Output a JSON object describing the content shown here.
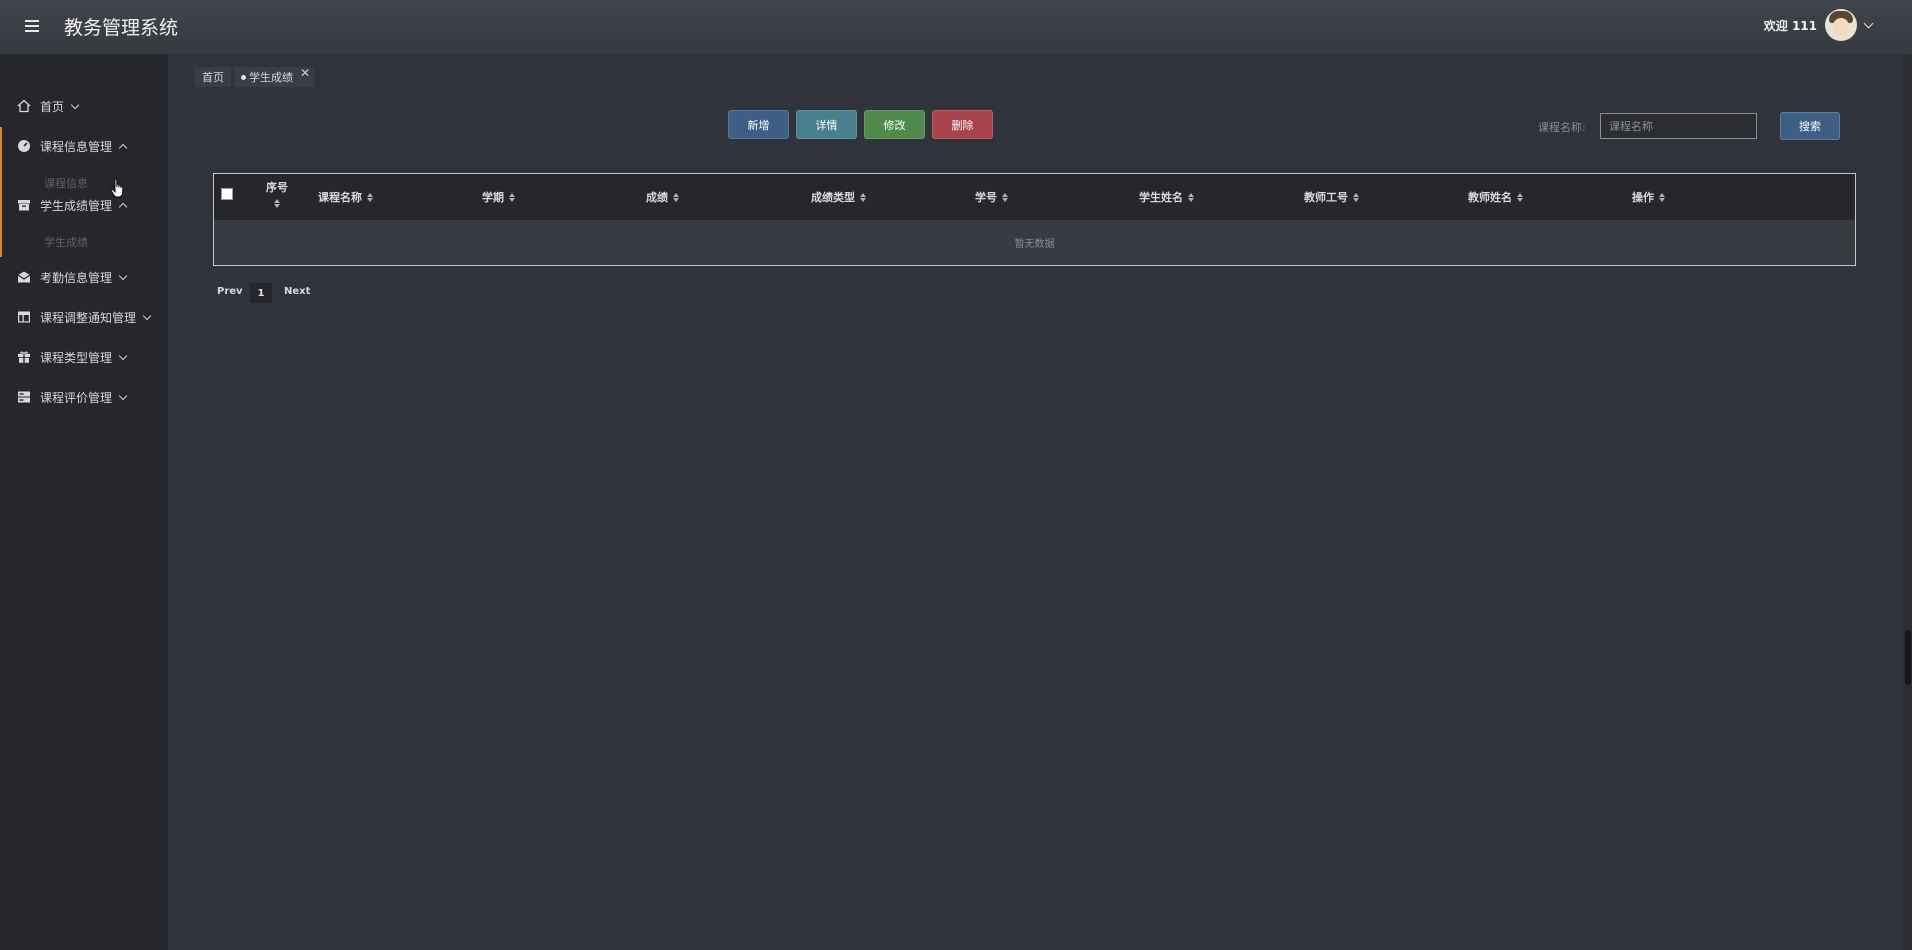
{
  "header": {
    "title": "教务管理系统",
    "welcome": "欢迎 111"
  },
  "sidebar": {
    "items": [
      {
        "label": "首页",
        "icon": "home-icon"
      },
      {
        "label": "课程信息管理",
        "icon": "dashboard-icon",
        "expanded": true
      },
      {
        "label": "学生成绩管理",
        "icon": "archive-icon",
        "expanded": true
      },
      {
        "label": "考勤信息管理",
        "icon": "envelope-icon"
      },
      {
        "label": "课程调整通知管理",
        "icon": "layout-icon"
      },
      {
        "label": "课程类型管理",
        "icon": "gift-icon"
      },
      {
        "label": "课程评价管理",
        "icon": "server-icon"
      }
    ],
    "sub_items": {
      "course_info": "课程信息",
      "student_grades": "学生成绩"
    }
  },
  "tabs": [
    {
      "label": "首页"
    },
    {
      "label": "学生成绩",
      "active": true
    }
  ],
  "tab_close": "✕",
  "toolbar": {
    "add": "新增",
    "detail": "详情",
    "edit": "修改",
    "delete": "删除"
  },
  "search": {
    "label": "课程名称:",
    "placeholder": "课程名称",
    "button": "搜索"
  },
  "table": {
    "columns": [
      "序号",
      "课程名称",
      "学期",
      "成绩",
      "成绩类型",
      "学号",
      "学生姓名",
      "教师工号",
      "教师姓名",
      "操作"
    ],
    "empty_text": "暂无数据"
  },
  "pagination": {
    "prev": "Prev",
    "page": "1",
    "next": "Next"
  },
  "colors": {
    "accent": "#d9822b",
    "primary": "#3d5f85",
    "info": "#477f8c",
    "success": "#4d8a4b",
    "danger": "#a8434c"
  }
}
